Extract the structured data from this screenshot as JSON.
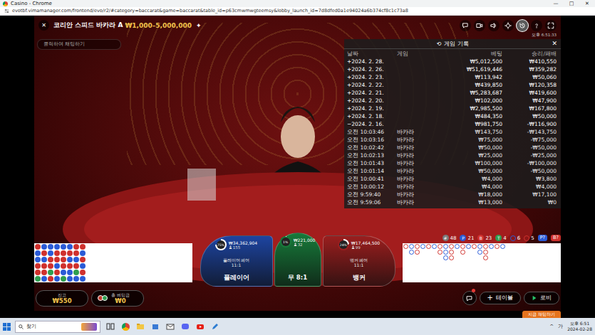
{
  "window": {
    "title": "Casino - Chrome",
    "url": "evotbf.vimamanager.com/frontend/evo/r2/#category=baccarat&game=baccarat&table_id=p63cmwmwgteemsy&lobby_launch_id=7d8dfed0a1e94024a6b374cf8c1c73a8",
    "controls": [
      "—",
      "□",
      "✕"
    ]
  },
  "game": {
    "close": "✕",
    "title": "코리안 스피드 바카라 A",
    "limits": "₩1,000–5,000,000",
    "star": "✦",
    "clock": "오후 6:51:33",
    "chatPlaceholder": "클릭하여 채팅하기",
    "historyOpen": true
  },
  "history": {
    "icon": "⟲",
    "title": "게임 기록",
    "close": "✕",
    "columns": [
      "날짜",
      "게임",
      "베팅",
      "승리/패배"
    ],
    "rows": [
      {
        "kind": "day",
        "date": "+2024. 2. 28.",
        "game": "",
        "bet": "₩5,012,500",
        "result": "₩410,550"
      },
      {
        "kind": "day",
        "date": "+2024. 2. 26.",
        "game": "",
        "bet": "₩51,619,446",
        "result": "₩359,282"
      },
      {
        "kind": "day",
        "date": "+2024. 2. 23.",
        "game": "",
        "bet": "₩113,942",
        "result": "₩50,060"
      },
      {
        "kind": "day",
        "date": "+2024. 2. 22.",
        "game": "",
        "bet": "₩439,850",
        "result": "₩120,358"
      },
      {
        "kind": "day",
        "date": "+2024. 2. 21.",
        "game": "",
        "bet": "₩5,283,687",
        "result": "₩419,600"
      },
      {
        "kind": "day",
        "date": "+2024. 2. 20.",
        "game": "",
        "bet": "₩102,000",
        "result": "₩47,900"
      },
      {
        "kind": "day",
        "date": "+2024. 2. 19.",
        "game": "",
        "bet": "₩2,985,500",
        "result": "₩167,800"
      },
      {
        "kind": "day",
        "date": "+2024. 2. 18.",
        "game": "",
        "bet": "₩484,350",
        "result": "₩50,000"
      },
      {
        "kind": "day",
        "date": "−2024. 2. 16.",
        "game": "",
        "bet": "₩981,750",
        "result": "-₩116,900"
      },
      {
        "kind": "round",
        "date": "오전 10:03:46",
        "game": "바카라",
        "bet": "₩143,750",
        "result": "-₩143,750"
      },
      {
        "kind": "round",
        "date": "오전 10:03:16",
        "game": "바카라",
        "bet": "₩75,000",
        "result": "-₩75,000"
      },
      {
        "kind": "round",
        "date": "오전 10:02:42",
        "game": "바카라",
        "bet": "₩50,000",
        "result": "-₩50,000"
      },
      {
        "kind": "round",
        "date": "오전 10:02:13",
        "game": "바카라",
        "bet": "₩25,000",
        "result": "-₩25,000"
      },
      {
        "kind": "round",
        "date": "오전 10:01:43",
        "game": "바카라",
        "bet": "₩100,000",
        "result": "-₩100,000"
      },
      {
        "kind": "round",
        "date": "오전 10:01:14",
        "game": "바카라",
        "bet": "₩50,000",
        "result": "-₩50,000"
      },
      {
        "kind": "round",
        "date": "오전 10:00:41",
        "game": "바카라",
        "bet": "₩4,000",
        "result": "₩3,800"
      },
      {
        "kind": "round",
        "date": "오전 10:00:12",
        "game": "바카라",
        "bet": "₩4,000",
        "result": "₩4,000"
      },
      {
        "kind": "round",
        "date": "오전 9:59:40",
        "game": "바카라",
        "bet": "₩18,000",
        "result": "₩17,100"
      },
      {
        "kind": "round",
        "date": "오전 9:59:06",
        "game": "바카라",
        "bet": "₩13,000",
        "result": "₩0"
      }
    ]
  },
  "stats": [
    {
      "kind": "badge",
      "label": "#",
      "value": "48",
      "color": "#7a7a7a"
    },
    {
      "kind": "badge",
      "label": "P",
      "value": "21",
      "color": "#2a5bd7"
    },
    {
      "kind": "badge",
      "label": "B",
      "value": "23",
      "color": "#d0312d"
    },
    {
      "kind": "badge",
      "label": "T",
      "value": "4",
      "color": "#2e9e4f"
    },
    {
      "kind": "pair",
      "label": "",
      "value": "6",
      "color": "#2a5bd7"
    },
    {
      "kind": "pair",
      "label": "",
      "value": "5",
      "color": "#d0312d"
    }
  ],
  "ask": [
    {
      "label": "P?",
      "color": "#2a5bd7"
    },
    {
      "label": "B?",
      "color": "#d0312d"
    }
  ],
  "spots": [
    {
      "kind": "player",
      "name": "플레이어",
      "pair": "플레이어 페어",
      "pairOdds": "11:1",
      "percent": "75%",
      "level": 0.75,
      "amount": "₩34,362,904",
      "players": "155",
      "color": "#1d44a0"
    },
    {
      "kind": "tie",
      "name": "무 8:1",
      "pair": "",
      "pairOdds": "",
      "percent": "1%",
      "level": 0.01,
      "amount": "₩221,000",
      "players": "32",
      "color": "#177a3a"
    },
    {
      "kind": "banker",
      "name": "뱅커",
      "pair": "뱅커 페어",
      "pairOdds": "11:1",
      "percent": "24%",
      "level": 0.24,
      "amount": "₩17,464,500",
      "players": "99",
      "color": "#9a1e1e"
    }
  ],
  "beads": [
    {
      "color": "#d0312d"
    },
    {
      "color": "#2a5bd7"
    },
    {
      "color": "#2a5bd7"
    },
    {
      "color": "#d0312d"
    },
    {
      "color": "#d0312d"
    },
    {
      "color": "#2e9e4f"
    },
    {
      "color": "#2a5bd7"
    },
    {
      "color": "#d0312d"
    },
    {
      "color": "#2a5bd7"
    },
    {
      "color": "#d0312d"
    },
    {
      "color": "#d0312d"
    },
    {
      "color": "#2a5bd7"
    },
    {
      "color": "#2a5bd7"
    },
    {
      "color": "#2a5bd7"
    },
    {
      "color": "#d0312d"
    },
    {
      "color": "#d0312d"
    },
    {
      "color": "#2e9e4f"
    },
    {
      "color": "#d0312d"
    },
    {
      "color": "#2a5bd7"
    },
    {
      "color": "#d0312d"
    },
    {
      "color": "#d0312d"
    },
    {
      "color": "#2a5bd7"
    },
    {
      "color": "#d0312d"
    },
    {
      "color": "#2a5bd7"
    },
    {
      "color": "#2a5bd7"
    },
    {
      "color": "#d0312d"
    },
    {
      "color": "#d0312d"
    },
    {
      "color": "#d0312d"
    },
    {
      "color": "#2a5bd7"
    },
    {
      "color": "#2e9e4f"
    },
    {
      "color": "#2a5bd7"
    },
    {
      "color": "#d0312d"
    },
    {
      "color": "#2a5bd7"
    },
    {
      "color": "#d0312d"
    },
    {
      "color": "#2a5bd7"
    },
    {
      "color": "#2a5bd7"
    },
    {
      "color": "#d0312d"
    },
    {
      "color": "#d0312d"
    },
    {
      "color": "#2a5bd7"
    },
    {
      "color": "#d0312d"
    },
    {
      "color": "#2e9e4f"
    },
    {
      "color": "#2a5bd7"
    },
    {
      "color": "#d0312d"
    },
    {
      "color": "#2a5bd7"
    },
    {
      "color": "#d0312d"
    },
    {
      "color": "#2a5bd7"
    },
    {
      "color": "#d0312d"
    },
    {
      "color": "#2a5bd7"
    }
  ],
  "bigRoad": [
    {
      "color": "#d0312d",
      "count": 1
    },
    {
      "color": "#2a5bd7",
      "count": 2
    },
    {
      "color": "#d0312d",
      "count": 2
    },
    {
      "color": "#2a5bd7",
      "count": 1
    },
    {
      "color": "#d0312d",
      "count": 1
    },
    {
      "color": "#2a5bd7",
      "count": 1
    },
    {
      "color": "#d0312d",
      "count": 2
    },
    {
      "color": "#2a5bd7",
      "count": 3
    },
    {
      "color": "#d0312d",
      "count": 3
    },
    {
      "color": "#2a5bd7",
      "count": 1
    },
    {
      "color": "#d0312d",
      "count": 2
    },
    {
      "color": "#2a5bd7",
      "count": 1
    },
    {
      "color": "#d0312d",
      "count": 1
    },
    {
      "color": "#2a5bd7",
      "count": 2
    },
    {
      "color": "#d0312d",
      "count": 3
    },
    {
      "color": "#2a5bd7",
      "count": 1
    },
    {
      "color": "#d0312d",
      "count": 1
    },
    {
      "color": "#2a5bd7",
      "count": 1
    }
  ],
  "bottomBar": {
    "balanceLabel": "잔고",
    "balance": "₩550",
    "betLabel": "총 베팅금",
    "bet": "₩0",
    "tableIcon": "+",
    "tableLabel": "테이블",
    "lobbyLabel": "로비"
  },
  "toast": "지금 채팅하기",
  "taskbar": {
    "search": "찾기",
    "tray": [
      "^",
      "가"
    ],
    "time": "오후 6:51",
    "date": "2024-02-28"
  }
}
